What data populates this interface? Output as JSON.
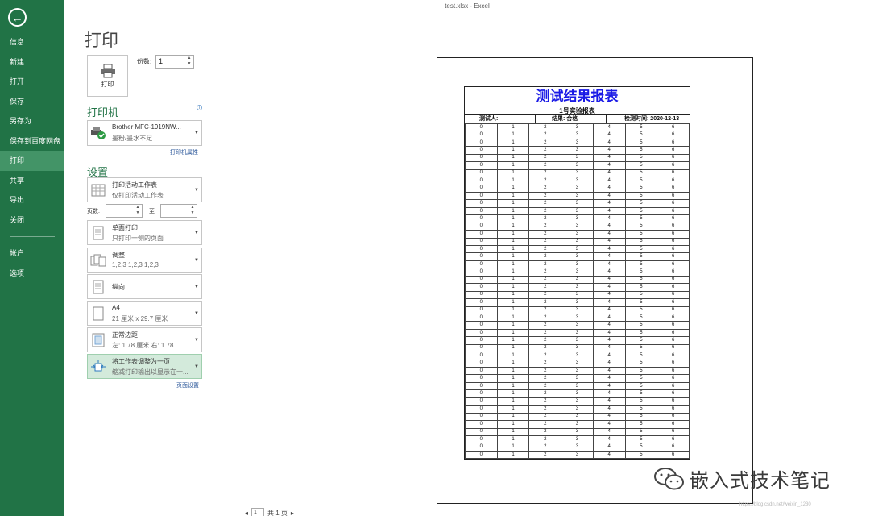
{
  "window": {
    "title": "test.xlsx - Excel"
  },
  "sidebar": {
    "back_icon": "arrow-left-circle-icon",
    "items": [
      "信息",
      "新建",
      "打开",
      "保存",
      "另存为",
      "保存到百度网盘",
      "打印",
      "共享",
      "导出",
      "关闭"
    ],
    "items2": [
      "帐户",
      "选项"
    ],
    "active": "打印"
  },
  "print": {
    "title": "打印",
    "button_label": "打印",
    "copies_label": "份数:",
    "copies_value": "1"
  },
  "printer": {
    "heading": "打印机",
    "name": "Brother MFC-1919NW...",
    "status": "墨粉/墨水不足",
    "properties_link": "打印机属性"
  },
  "settings": {
    "heading": "设置",
    "scope": {
      "title": "打印活动工作表",
      "desc": "仅打印活动工作表"
    },
    "pages_label": "页数:",
    "to_label": "至",
    "sides": {
      "title": "单面打印",
      "desc": "只打印一侧的页面"
    },
    "collate": {
      "title": "调整",
      "desc": "1,2,3    1,2,3    1,2,3"
    },
    "orientation": {
      "title": "纵向"
    },
    "paper": {
      "title": "A4",
      "desc": "21 厘米 x 29.7 厘米"
    },
    "margins": {
      "title": "正常边距",
      "desc": "左: 1.78 厘米    右: 1.78..."
    },
    "scaling": {
      "title": "将工作表调整为一页",
      "desc": "缩减打印输出以显示在一..."
    },
    "page_setup_link": "页面设置"
  },
  "preview": {
    "sheet_title": "测试结果报表",
    "subtitle": "1号实验报表",
    "tester_label": "测试人:",
    "result_label": "结果:",
    "result_value": "合格",
    "time_label": "检测时间:",
    "time_value": "2020-12-13",
    "row_values": [
      "0",
      "1",
      "2",
      "3",
      "4",
      "5",
      "6"
    ],
    "row_count": 44
  },
  "page_nav": {
    "current": "1",
    "total_label": "共 1 页"
  },
  "watermark": {
    "text": "嵌入式技术笔记",
    "url": "https://blog.csdn.net/weixin_1230"
  }
}
